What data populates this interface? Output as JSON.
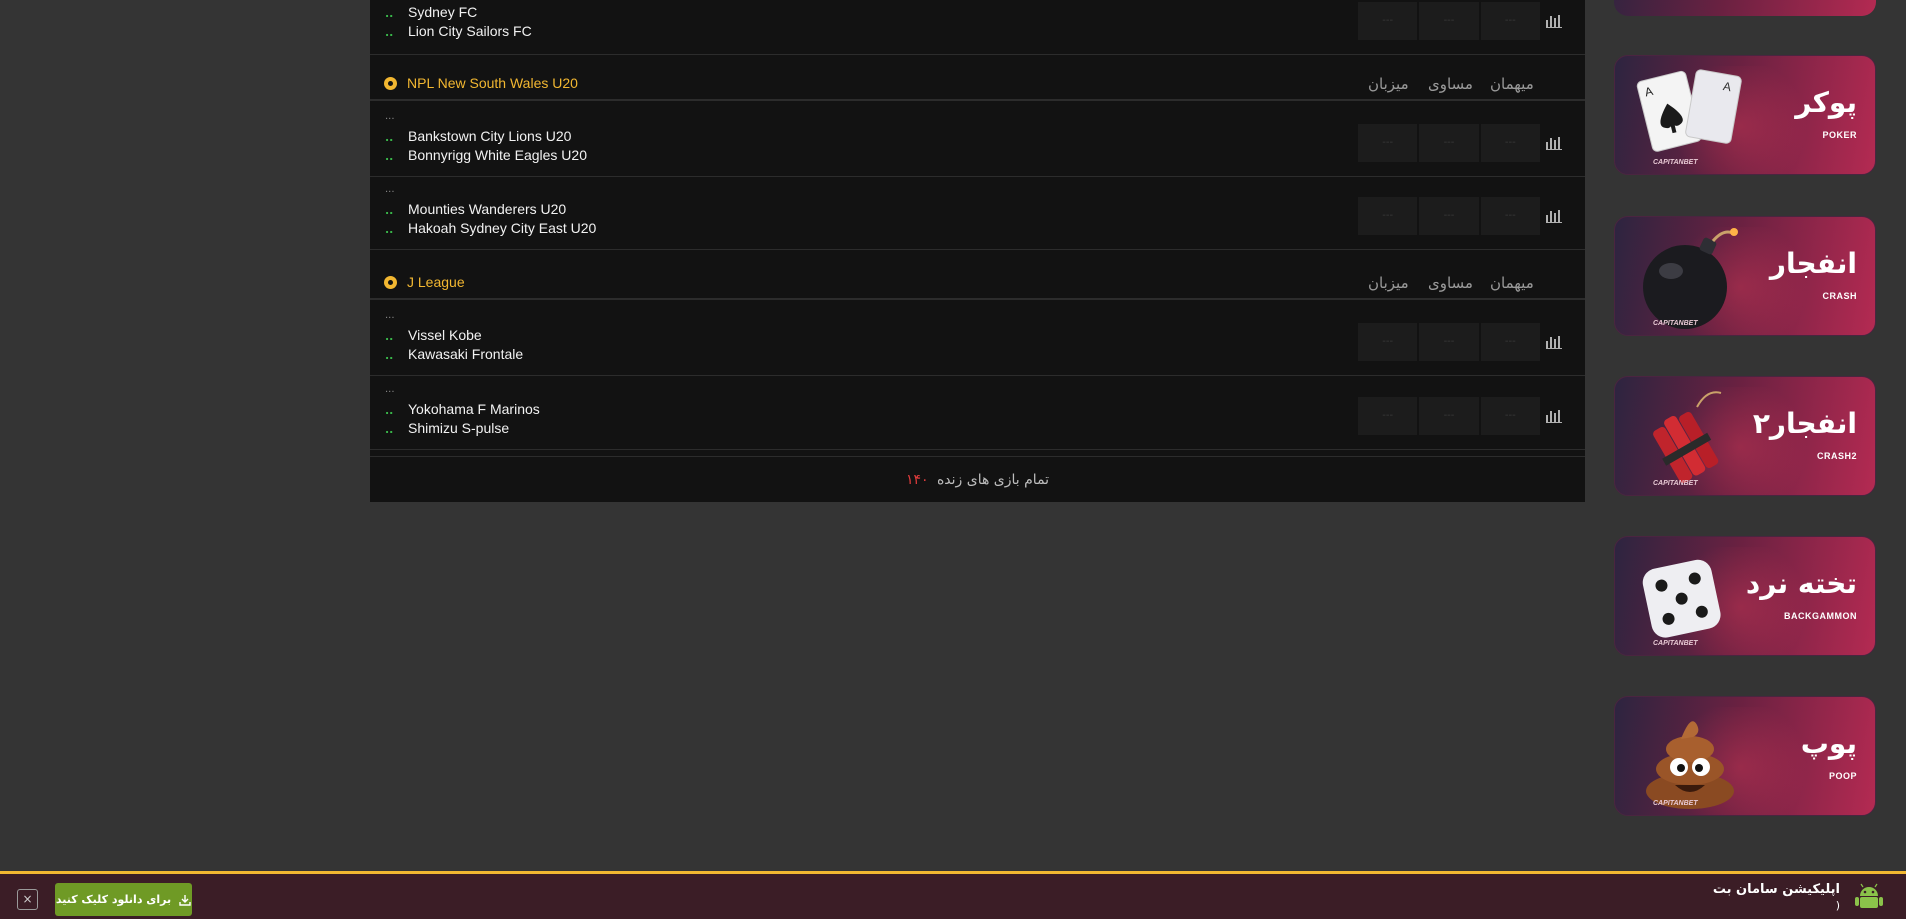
{
  "live": {
    "top_match": {
      "home": "Sydney FC",
      "away": "Lion City Sailors FC",
      "home_score": "..",
      "away_score": ".."
    },
    "leagues": [
      {
        "name": "NPL New South Wales U20",
        "col_home": "میزبان",
        "col_draw": "مساوی",
        "col_away": "میهمان",
        "matches": [
          {
            "time": "...",
            "home": "Bankstown City Lions U20",
            "away": "Bonnyrigg White Eagles U20",
            "home_score": "..",
            "away_score": ".."
          },
          {
            "time": "...",
            "home": "Mounties Wanderers U20",
            "away": "Hakoah Sydney City East U20",
            "home_score": "..",
            "away_score": ".."
          }
        ]
      },
      {
        "name": "J League",
        "col_home": "میزبان",
        "col_draw": "مساوی",
        "col_away": "میهمان",
        "matches": [
          {
            "time": "...",
            "home": "Vissel Kobe",
            "away": "Kawasaki Frontale",
            "home_score": "..",
            "away_score": ".."
          },
          {
            "time": "...",
            "home": "Yokohama F Marinos",
            "away": "Shimizu S-pulse",
            "home_score": "..",
            "away_score": ".."
          }
        ]
      }
    ],
    "odds_placeholder": "---",
    "all_live_label": "تمام بازی های زنده",
    "all_live_count": "۱۴۰"
  },
  "banners": [
    {
      "title": "پوکر",
      "sub": "POKER",
      "brand": "CAPITANBET",
      "icon": "poker-cards-icon"
    },
    {
      "title": "انفجار",
      "sub": "CRASH",
      "brand": "CAPITANBET",
      "icon": "bomb-icon"
    },
    {
      "title": "انفجار۲",
      "sub": "CRASH2",
      "brand": "CAPITANBET",
      "icon": "dynamite-icon"
    },
    {
      "title": "تخته نرد",
      "sub": "BACKGAMMON",
      "brand": "CAPITANBET",
      "icon": "dice-icon"
    },
    {
      "title": "پوپ",
      "sub": "POOP",
      "brand": "CAPITANBET",
      "icon": "poop-icon"
    }
  ],
  "appbar": {
    "title": "اپلیکیشن سامان بت",
    "subtitle": ")",
    "download_label": "برای دانلود کلیک کنید",
    "close_symbol": "×"
  },
  "colors": {
    "accent": "#f2b731",
    "score": "#39b54a",
    "count": "#e03c3c",
    "download": "#6f9a25"
  }
}
